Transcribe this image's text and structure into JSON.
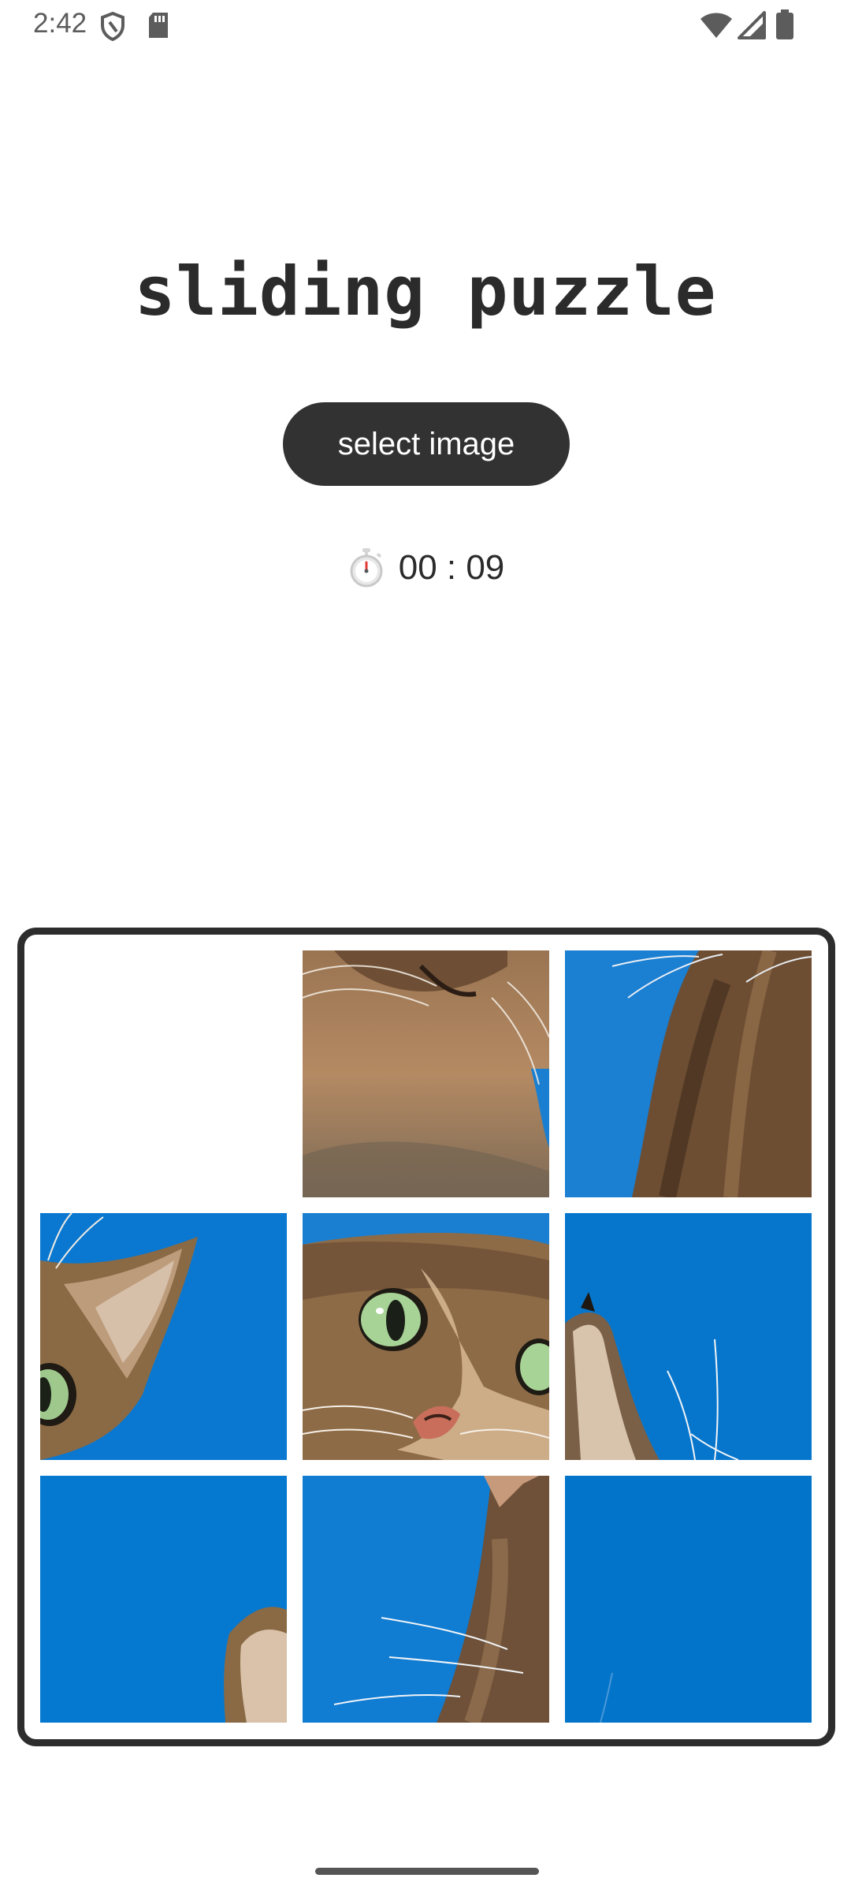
{
  "status_bar": {
    "time": "2:42",
    "icons": [
      "shield-icon",
      "sd-card-icon",
      "wifi-icon",
      "cell-signal-icon",
      "battery-icon"
    ]
  },
  "title": "sliding puzzle",
  "select_button": {
    "label": "select image"
  },
  "timer": {
    "icon": "stopwatch-icon",
    "value": "00 : 09"
  },
  "board": {
    "grid": "3x3",
    "image": "tabby cat face on blue sky",
    "colors": {
      "sky": "#0a78d0",
      "fur": "#8a6a45",
      "eye": "#9fc98c",
      "border": "#2d2d2d"
    },
    "tiles": [
      {
        "id": "empty",
        "state": "empty"
      },
      {
        "id": "chin-whiskers",
        "state": "filled"
      },
      {
        "id": "back-of-head-sky",
        "state": "filled"
      },
      {
        "id": "left-ear-eye",
        "state": "filled"
      },
      {
        "id": "face-eyes-nose",
        "state": "filled"
      },
      {
        "id": "right-ear-sky",
        "state": "filled"
      },
      {
        "id": "sky-ear-tip",
        "state": "filled"
      },
      {
        "id": "sky-cheek-fur",
        "state": "filled"
      },
      {
        "id": "plain-sky",
        "state": "filled"
      }
    ]
  }
}
